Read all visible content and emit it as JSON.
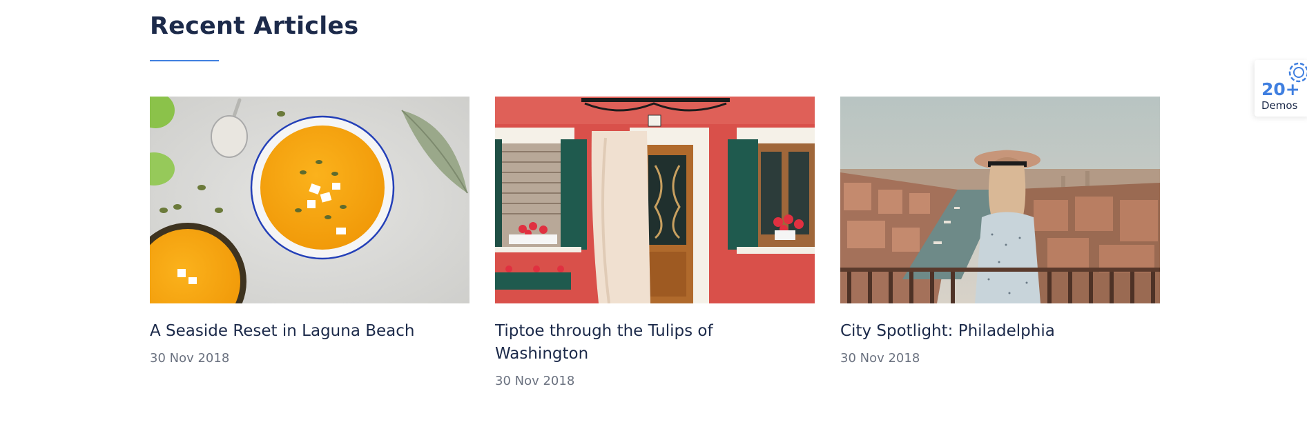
{
  "section": {
    "title": "Recent Articles"
  },
  "articles": [
    {
      "title": "A Seaside Reset in Laguna Beach",
      "date": "30 Nov 2018",
      "image": "soup-bowls-photo"
    },
    {
      "title": "Tiptoe through the Tulips of Washington",
      "date": "30 Nov 2018",
      "image": "red-house-door-photo"
    },
    {
      "title": "City Spotlight: Philadelphia",
      "date": "30 Nov 2018",
      "image": "woman-overlooking-canal-photo"
    }
  ],
  "demos_badge": {
    "count": "20+",
    "label": "Demos",
    "icon": "gear-icon"
  },
  "colors": {
    "accent": "#3f7fe0",
    "heading": "#1c2a4a",
    "muted": "#6b7280"
  }
}
